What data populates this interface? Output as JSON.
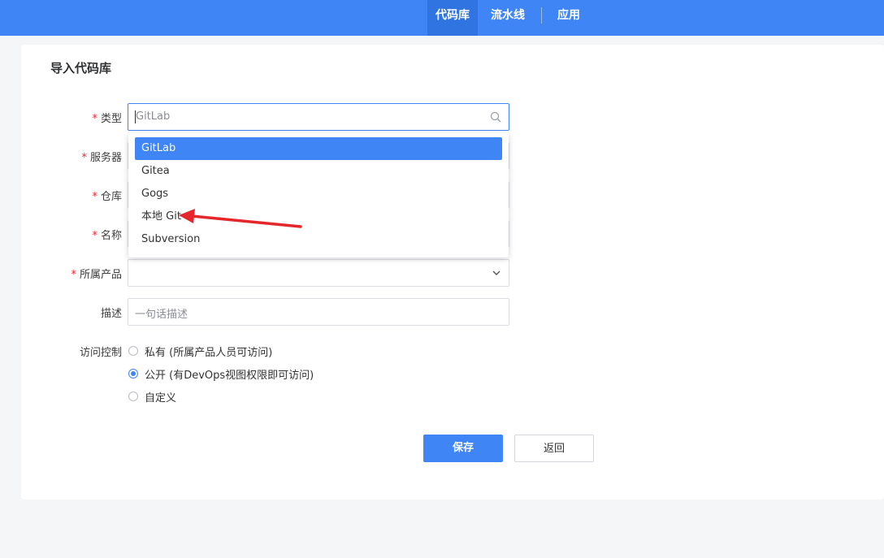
{
  "nav": {
    "items": [
      {
        "label": "代码库",
        "active": true
      },
      {
        "label": "流水线",
        "active": false
      },
      {
        "label": "应用",
        "active": false
      }
    ]
  },
  "page": {
    "title": "导入代码库"
  },
  "form": {
    "type": {
      "label": "类型",
      "value": "GitLab",
      "required": true
    },
    "server": {
      "label": "服务器",
      "required": true
    },
    "repo": {
      "label": "仓库",
      "required": true
    },
    "name": {
      "label": "名称",
      "required": true
    },
    "product": {
      "label": "所属产品",
      "required": true,
      "value": ""
    },
    "desc": {
      "label": "描述",
      "placeholder": "一句话描述"
    },
    "access": {
      "label": "访问控制",
      "options": [
        {
          "label": "私有 (所属产品人员可访问)",
          "checked": false
        },
        {
          "label": "公开 (有DevOps视图权限即可访问)",
          "checked": true
        },
        {
          "label": "自定义",
          "checked": false
        }
      ]
    },
    "required_mark": "*"
  },
  "dropdown": {
    "options": [
      "GitLab",
      "Gitea",
      "Gogs",
      "本地 Git",
      "Subversion"
    ],
    "selected": "GitLab"
  },
  "buttons": {
    "save": "保存",
    "back": "返回"
  },
  "colors": {
    "primary": "#3f85f5",
    "annotation_arrow": "#e5262a",
    "required": "#f5222d"
  }
}
